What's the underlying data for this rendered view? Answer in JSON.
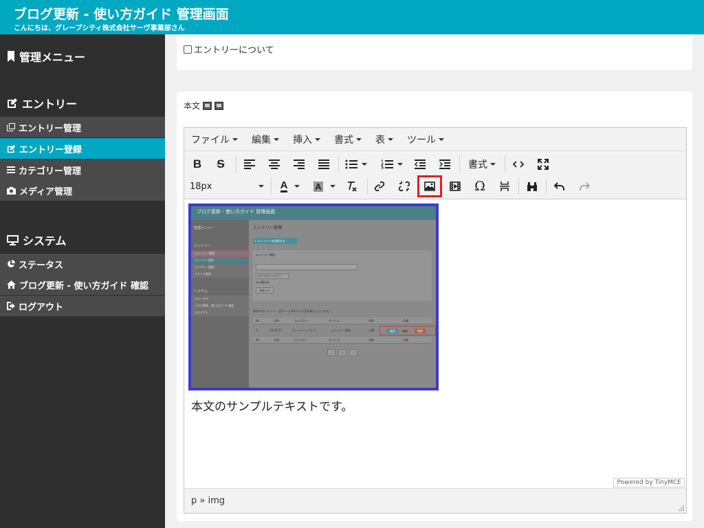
{
  "header": {
    "title": "ブログ更新 - 使い方ガイド 管理画面",
    "greeting": "こんにちは、グレープシティ株式会社サーヴ事業部さん"
  },
  "sidebar": {
    "menu_title": "管理メニュー",
    "entry_section": "エントリー",
    "entry_items": [
      "エントリー管理",
      "エントリー登録",
      "カテゴリー管理",
      "メディア管理"
    ],
    "system_section": "システム",
    "system_items": [
      "ステータス",
      "ブログ更新 - 使い方ガイド 確認",
      "ログアウト"
    ],
    "active_item": "エントリー登録"
  },
  "top_panel": {
    "checkbox_label": "エントリーについて",
    "checked": false
  },
  "body_field": {
    "label": "本文"
  },
  "editor": {
    "menus": [
      "ファイル",
      "編集",
      "挿入",
      "書式",
      "表",
      "ツール"
    ],
    "format_dropdown": "書式",
    "font_size": "18px",
    "body_text": "本文のサンプルテキストです。",
    "path": "p » img",
    "powered": "Powered by TinyMCE",
    "highlighted_button": "insert-image"
  },
  "thumbnail": {
    "title": "ブログ更新 - 使い方ガイド 管理画面",
    "page_title": "エントリー管理",
    "add_button": "+ エントリーを登録する",
    "search_title": "エントリー検索",
    "category_select": "すべてのカテゴリー",
    "unpublished": "未公開のみ",
    "search_button": "検索する",
    "count_text": "39件のエントリー。全3ページ中1ページ目を表示しています。",
    "columns": [
      "No",
      "日時",
      "カテゴリー",
      "タイトル",
      "状態",
      "作業"
    ],
    "row": [
      "1",
      "13:04:57",
      "エントリーについて",
      "エントリー登録",
      "公開",
      "確認",
      "編集",
      "削除"
    ],
    "nav_menu": "管理メニュー",
    "nav_entry": "エントリー",
    "nav_items": [
      "エントリー管理",
      "エントリー登録",
      "カテゴリー管理",
      "メディア管理"
    ],
    "nav_system": "システム",
    "nav_system_items": [
      "ステータス",
      "ブログ更新 - 使い方ガイド 確認",
      "ログアウト"
    ]
  },
  "colors": {
    "accent": "#00a9c1",
    "sidebar": "#2f2f2f",
    "highlight": "#e02020",
    "image_border": "#3b3dc9"
  }
}
